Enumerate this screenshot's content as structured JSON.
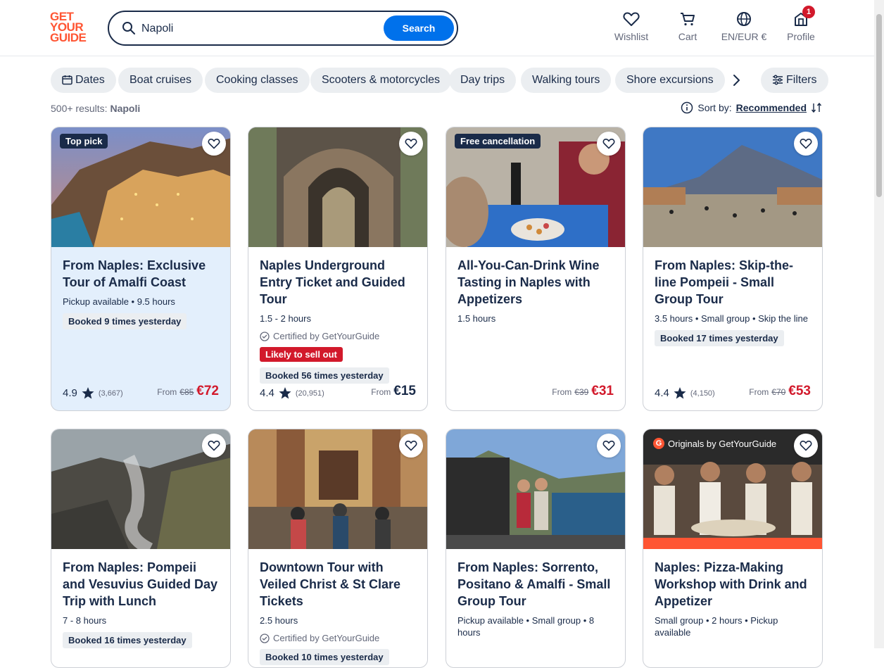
{
  "logo": {
    "lines": [
      "GET",
      "YOUR",
      "GUIDE"
    ]
  },
  "search": {
    "value": "Napoli",
    "button": "Search"
  },
  "nav": {
    "wishlist": "Wishlist",
    "cart": "Cart",
    "language": "EN/EUR €",
    "profile": "Profile",
    "profile_badge": "1"
  },
  "chips": [
    "Dates",
    "Boat cruises",
    "Cooking classes",
    "Scooters & motorcycles",
    "Day trips",
    "Walking tours",
    "Shore excursions"
  ],
  "filters_label": "Filters",
  "results": {
    "count": "500+ results:",
    "query": "Napoli"
  },
  "sort": {
    "label": "Sort by:",
    "value": "Recommended"
  },
  "colors": {
    "brand": "#ff5533",
    "primary": "#0071eb",
    "navy": "#1a2b49",
    "sale": "#d2192b"
  },
  "cards": [
    {
      "tag": "Top pick",
      "title": "From Naples: Exclusive Tour of Amalfi Coast",
      "meta": "Pickup available • 9.5 hours",
      "booked": "Booked 9 times yesterday",
      "rating": "4.9",
      "reviews": "(3,667)",
      "from": "From",
      "old_price": "€85",
      "price": "€72"
    },
    {
      "title": "Naples Underground Entry Ticket and Guided Tour",
      "meta": "1.5 - 2 hours",
      "certified": "Certified by GetYourGuide",
      "sellout": "Likely to sell out",
      "booked": "Booked 56 times yesterday",
      "rating": "4.4",
      "reviews": "(20,951)",
      "from": "From",
      "price": "€15"
    },
    {
      "tag": "Free cancellation",
      "title": "All-You-Can-Drink Wine Tasting in Naples with Appetizers",
      "meta": "1.5 hours",
      "from": "From",
      "old_price": "€39",
      "price": "€31"
    },
    {
      "title": "From Naples: Skip-the-line Pompeii - Small Group Tour",
      "meta": "3.5 hours • Small group • Skip the line",
      "booked": "Booked 17 times yesterday",
      "rating": "4.4",
      "reviews": "(4,150)",
      "from": "From",
      "old_price": "€70",
      "price": "€53"
    },
    {
      "title": "From Naples: Pompeii and Vesuvius Guided Day Trip with Lunch",
      "meta": "7 - 8 hours",
      "booked": "Booked 16 times yesterday"
    },
    {
      "title": "Downtown Tour with Veiled Christ & St Clare Tickets",
      "meta": "2.5 hours",
      "certified": "Certified by GetYourGuide",
      "booked": "Booked 10 times yesterday"
    },
    {
      "title": "From Naples: Sorrento, Positano & Amalfi - Small Group Tour",
      "meta": "Pickup available • Small group • 8 hours"
    },
    {
      "tag": "Originals by GetYourGuide",
      "title": "Naples: Pizza-Making Workshop with Drink and Appetizer",
      "meta": "Small group • 2 hours • Pickup available"
    }
  ]
}
